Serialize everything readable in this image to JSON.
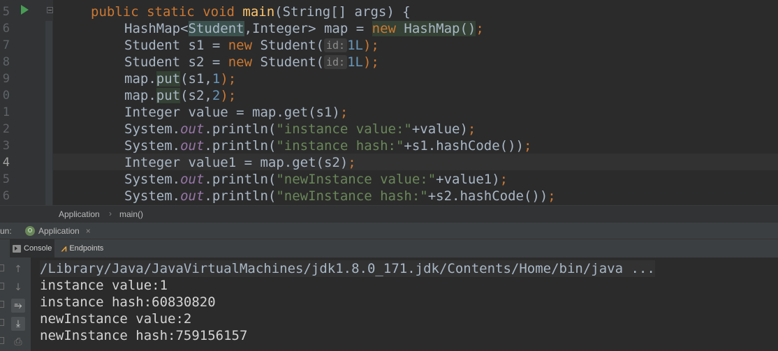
{
  "editor": {
    "line_numbers": [
      "5",
      "6",
      "7",
      "8",
      "9",
      "0",
      "1",
      "2",
      "3",
      "4",
      "5",
      "6"
    ],
    "code": {
      "l1": [
        "public",
        "static",
        "void",
        "main",
        "(String[] args) {"
      ],
      "l2": [
        "HashMap<",
        "Student",
        ",Integer> map = ",
        "new",
        " HashMap()",
        ";"
      ],
      "l3": [
        "Student s1 = ",
        "new",
        " Student(",
        "id:",
        "1L",
        ");"
      ],
      "l4": [
        "Student s2 = ",
        "new",
        " Student(",
        "id:",
        "1L",
        ");"
      ],
      "l5": [
        "map.",
        "put",
        "(s1,",
        "1",
        ");"
      ],
      "l6": [
        "map.",
        "put",
        "(s2,",
        "2",
        ");"
      ],
      "l7": [
        "Integer value = map.get(s1)",
        ";"
      ],
      "l8": [
        "System.",
        "out",
        ".println(",
        "\"instance value:\"",
        "+value)",
        ";"
      ],
      "l9": [
        "System.",
        "out",
        ".println(",
        "\"instance hash:\"",
        "+s1.hashCode())",
        ";"
      ],
      "l10": [
        "Integer value1 = map.get(s2)",
        ";"
      ],
      "l11": [
        "System.",
        "out",
        ".println(",
        "\"newInstance value:\"",
        "+value1)",
        ";"
      ],
      "l12": [
        "System.",
        "out",
        ".println(",
        "\"newInstance hash:\"",
        "+s2.hashCode())",
        ";"
      ]
    }
  },
  "breadcrumb": {
    "items": [
      "Application",
      "main()"
    ],
    "separator": "›"
  },
  "run_panel": {
    "label": "un:",
    "tab_label": "Application",
    "close_glyph": "×",
    "tool_tabs": [
      "Console",
      "Endpoints"
    ]
  },
  "console": {
    "lines": [
      "/Library/Java/JavaVirtualMachines/jdk1.8.0_171.jdk/Contents/Home/bin/java ...",
      "instance value:1",
      "instance hash:60830820",
      "newInstance value:2",
      "newInstance hash:759156157"
    ]
  },
  "icons": {
    "toolbar": [
      "arrow-up-icon",
      "arrow-down-icon",
      "soft-wrap-icon",
      "scroll-to-end-icon",
      "print-icon"
    ],
    "gutter": [
      "run-gutter-icon",
      "fold-icon"
    ]
  },
  "colors": {
    "background": "#2b2b2b",
    "keyword": "#cc7832",
    "method": "#ffc66d",
    "number": "#6897bb",
    "string": "#6a8759",
    "field": "#9876aa"
  }
}
